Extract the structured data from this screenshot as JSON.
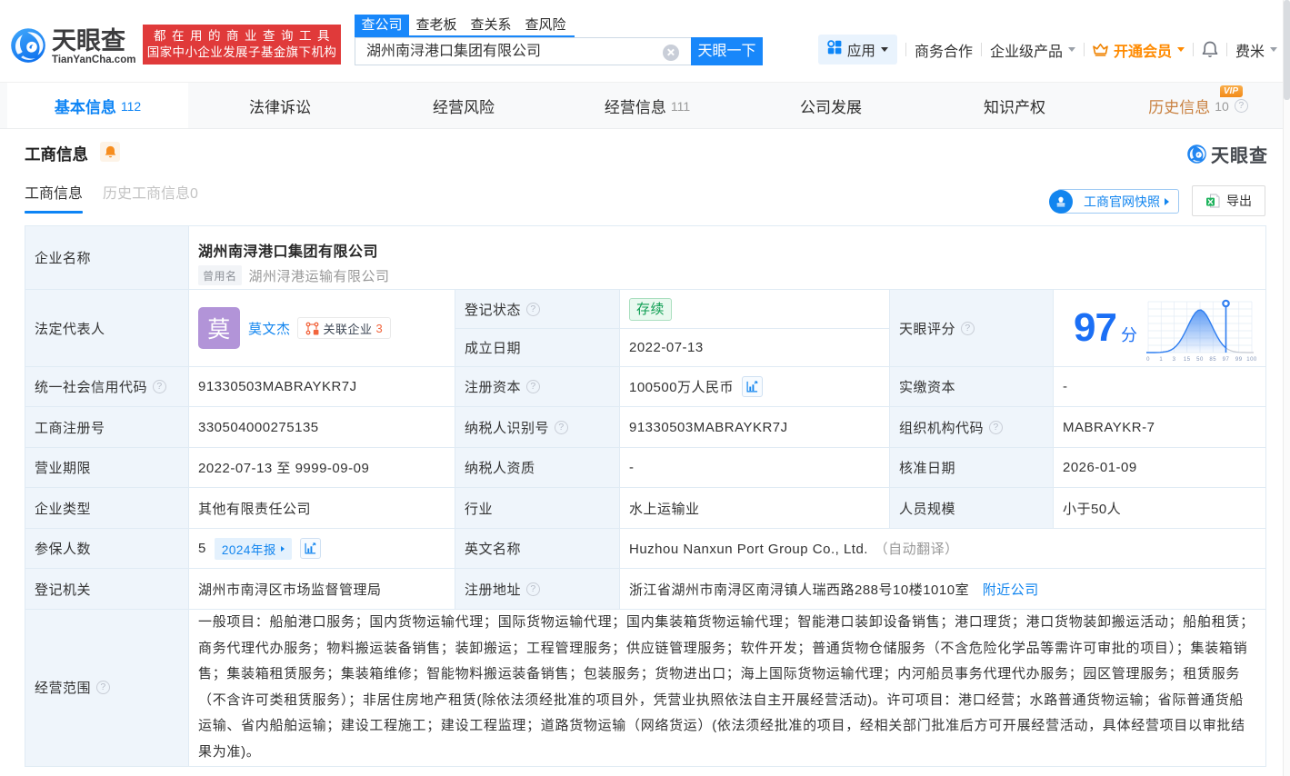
{
  "ui": {
    "q": "?",
    "vip": "VIP"
  },
  "header": {
    "logo_cn": "天眼查",
    "logo_en": "TianYanCha.com",
    "slogan_line1": "都在用的商业查询工具",
    "slogan_line2": "国家中小企业发展子基金旗下机构",
    "search_tabs": [
      {
        "label": "查公司"
      },
      {
        "label": "查老板"
      },
      {
        "label": "查关系"
      },
      {
        "label": "查风险"
      }
    ],
    "search_value": "湖州南浔港口集团有限公司",
    "search_button": "天眼一下",
    "menu_apps": "应用",
    "menu_cooperation": "商务合作",
    "menu_enterprise": "企业级产品",
    "menu_vip": "开通会员",
    "menu_user": "费米"
  },
  "nav_tabs": {
    "basic": {
      "label": "基本信息",
      "count": "112"
    },
    "legal": {
      "label": "法律诉讼"
    },
    "risk": {
      "label": "经营风险"
    },
    "operating": {
      "label": "经营信息",
      "count": "111"
    },
    "development": {
      "label": "公司发展"
    },
    "ip": {
      "label": "知识产权"
    },
    "history": {
      "label": "历史信息",
      "count": "10"
    }
  },
  "section": {
    "title": "工商信息",
    "watermark": "天眼查",
    "tab_current": "工商信息",
    "tab_history": "历史工商信息0",
    "snapshot_button": "工商官网快照",
    "export_button": "导出"
  },
  "table": {
    "company_name": {
      "label": "企业名称",
      "value": "湖州南浔港口集团有限公司",
      "former_tag": "曾用名",
      "former": "湖州浔港运输有限公司"
    },
    "legal_rep": {
      "label": "法定代表人",
      "avatar": "莫",
      "name": "莫文杰",
      "related_label": "关联企业",
      "related_count": "3"
    },
    "reg_status": {
      "label": "登记状态",
      "value": "存续"
    },
    "est_date": {
      "label": "成立日期",
      "value": "2022-07-13"
    },
    "score": {
      "label": "天眼评分",
      "value": "97",
      "unit": "分"
    },
    "credit_code": {
      "label": "统一社会信用代码",
      "value": "91330503MABRAYKR7J"
    },
    "reg_capital": {
      "label": "注册资本",
      "value": "100500万人民币"
    },
    "paid_capital": {
      "label": "实缴资本",
      "value": "-"
    },
    "reg_number": {
      "label": "工商注册号",
      "value": "330504000275135"
    },
    "taxpayer_id": {
      "label": "纳税人识别号",
      "value": "91330503MABRAYKR7J"
    },
    "org_code": {
      "label": "组织机构代码",
      "value": "MABRAYKR-7"
    },
    "term": {
      "label": "营业期限",
      "value": "2022-07-13 至 9999-09-09"
    },
    "taxpayer_qual": {
      "label": "纳税人资质",
      "value": "-"
    },
    "approval_date": {
      "label": "核准日期",
      "value": "2026-01-09"
    },
    "company_type": {
      "label": "企业类型",
      "value": "其他有限责任公司"
    },
    "industry": {
      "label": "行业",
      "value": "水上运输业"
    },
    "staff_size": {
      "label": "人员规模",
      "value": "小于50人"
    },
    "insured": {
      "label": "参保人数",
      "value": "5",
      "report_tag": "2024年报"
    },
    "english_name": {
      "label": "英文名称",
      "value": "Huzhou Nanxun Port Group Co., Ltd.",
      "note": "（自动翻译）"
    },
    "reg_authority": {
      "label": "登记机关",
      "value": "湖州市南浔区市场监督管理局"
    },
    "address": {
      "label": "注册地址",
      "value": "浙江省湖州市南浔区南浔镇人瑞西路288号10楼1010室",
      "nearby": "附近公司"
    },
    "business_scope": {
      "label": "经营范围",
      "value": "一般项目：船舶港口服务；国内货物运输代理；国际货物运输代理；国内集装箱货物运输代理；智能港口装卸设备销售；港口理货；港口货物装卸搬运活动；船舶租赁；商务代理代办服务；物料搬运装备销售；装卸搬运；工程管理服务；供应链管理服务；软件开发；普通货物仓储服务（不含危险化学品等需许可审批的项目）；集装箱销售；集装箱租赁服务；集装箱维修；智能物料搬运装备销售；包装服务；货物进出口；海上国际货物运输代理；内河船员事务代理代办服务；园区管理服务；租赁服务（不含许可类租赁服务）；非居住房地产租赁(除依法须经批准的项目外，凭营业执照依法自主开展经营活动)。许可项目：港口经营；水路普通货物运输；省际普通货船运输、省内船舶运输；建设工程施工；建设工程监理；道路货物运输（网络货运）(依法须经批准的项目，经相关部门批准后方可开展经营活动，具体经营项目以审批结果为准)。"
    }
  },
  "chart_data": {
    "type": "area",
    "title": "天眼评分",
    "score": 97,
    "unit": "分",
    "ticks": [
      "0",
      "1",
      "3",
      "15",
      "50",
      "85",
      "97",
      "99",
      "100"
    ],
    "marker_tick": "97",
    "curve": "normal-distribution bell peaking near tick 50, marker line at 97"
  }
}
